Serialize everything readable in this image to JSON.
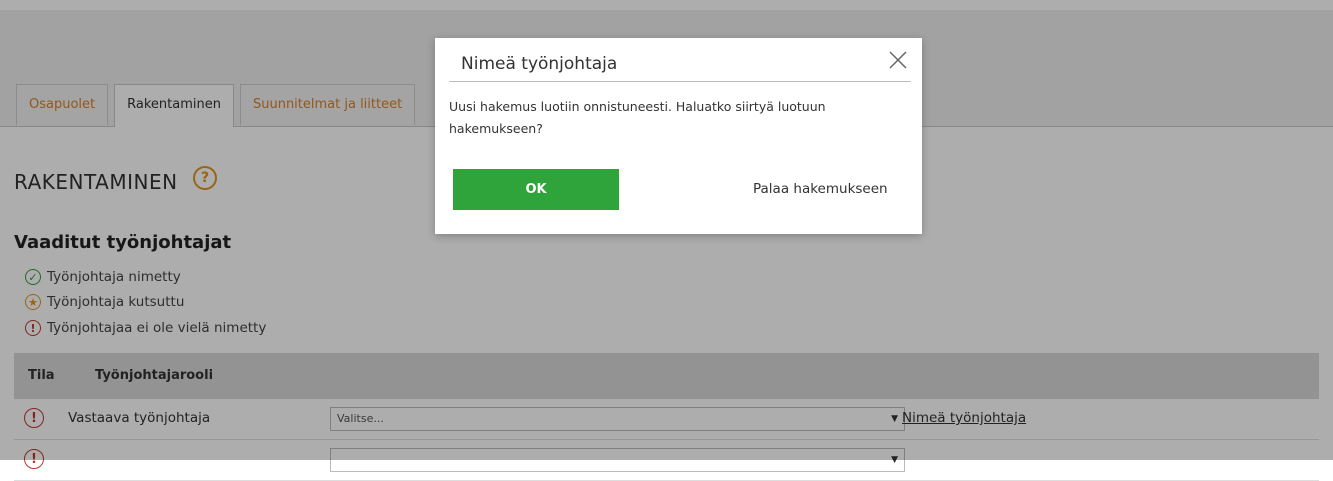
{
  "tabs": [
    {
      "label": "Osapuolet",
      "active": false
    },
    {
      "label": "Rakentaminen",
      "active": true
    },
    {
      "label": "Suunnitelmat ja liitteet",
      "active": false
    }
  ],
  "page": {
    "title": "RAKENTAMINEN",
    "help_icon": "question-circle-icon"
  },
  "section": {
    "title": "Vaaditut työnjohtajat"
  },
  "legend": [
    {
      "icon": "check-circle-icon",
      "label": "Työnjohtaja nimetty"
    },
    {
      "icon": "star-circle-icon",
      "label": "Työnjohtaja kutsuttu"
    },
    {
      "icon": "exclamation-circle-icon",
      "label": "Työnjohtajaa ei ole vielä nimetty"
    }
  ],
  "table": {
    "columns": [
      "Tila",
      "Työnjohtajarooli"
    ],
    "rows": [
      {
        "status_icon": "exclamation-circle-icon",
        "role": "Vastaava työnjohtaja",
        "select_value": "Valitse...",
        "link": "Nimeä työnjohtaja"
      },
      {
        "status_icon": "exclamation-circle-icon",
        "role": "",
        "select_value": "",
        "link": ""
      }
    ]
  },
  "modal": {
    "title": "Nimeä työnjohtaja",
    "message": "Uusi hakemus luotiin onnistuneesti. Haluatko siirtyä luotuun hakemukseen?",
    "ok_label": "OK",
    "back_label": "Palaa hakemukseen",
    "close_icon": "close-icon"
  },
  "colors": {
    "accent_orange": "#d9812a",
    "ok_green": "#2ea43a",
    "warn_red": "#c0392b",
    "done_green": "#2e9c3a"
  }
}
